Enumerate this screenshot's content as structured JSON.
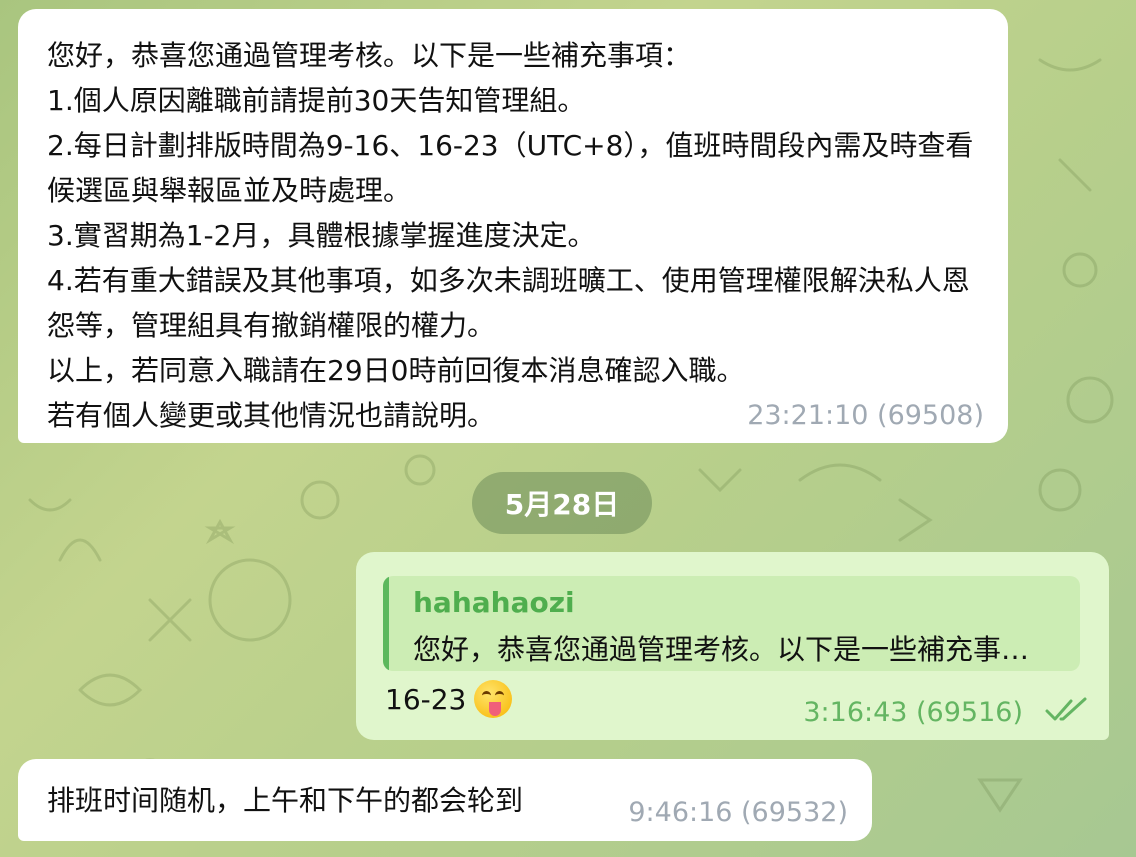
{
  "messages": {
    "incoming_1": {
      "text": "您好，恭喜您通過管理考核。以下是一些補充事項：\n1.個人原因離職前請提前30天告知管理組。\n2.每日計劃排版時間為9-16、16-23（UTC+8），值班時間段內需及時查看候選區與舉報區並及時處理。\n3.實習期為1-2月，具體根據掌握進度決定。\n4.若有重大錯誤及其他事項，如多次未調班曠工、使用管理權限解決私人恩怨等，管理組具有撤銷權限的權力。\n以上，若同意入職請在29日0時前回復本消息確認入職。\n若有個人變更或其他情況也請說明。",
      "time": "23:21:10 (69508)"
    },
    "date_separator": "5月28日",
    "outgoing": {
      "reply_author": "hahahaozi",
      "reply_preview": "您好，恭喜您通過管理考核。以下是一些補充事項：",
      "text": "16-23",
      "emoji": "face-with-tongue-emoji",
      "time": "3:16:43 (69516)",
      "status_icon": "double-check-icon"
    },
    "incoming_2": {
      "text": "排班时间随机，上午和下午的都会轮到",
      "time": "9:46:16 (69532)"
    }
  },
  "colors": {
    "background": "#b7cf8b",
    "outgoing_bubble": "#e0f6cc",
    "accent_green": "#4fae4e",
    "timestamp_gray": "#a0a9b3"
  }
}
